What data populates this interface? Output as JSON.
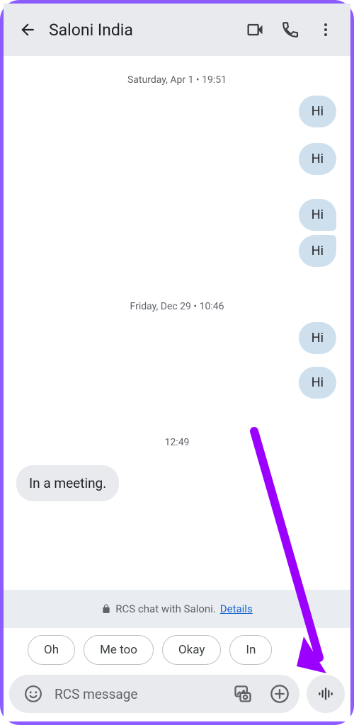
{
  "header": {
    "title": "Saloni India"
  },
  "dates": {
    "d1": "Saturday, Apr 1 • 19:51",
    "d2": "Friday, Dec 29 • 10:46",
    "d3": "12:49"
  },
  "messages": {
    "hi": "Hi",
    "meeting": "In a meeting."
  },
  "banner": {
    "text": "RCS chat with Saloni.",
    "link": "Details"
  },
  "suggestions": {
    "s1": "Oh",
    "s2": "Me too",
    "s3": "Okay",
    "s4": "In"
  },
  "input": {
    "placeholder": "RCS message"
  }
}
